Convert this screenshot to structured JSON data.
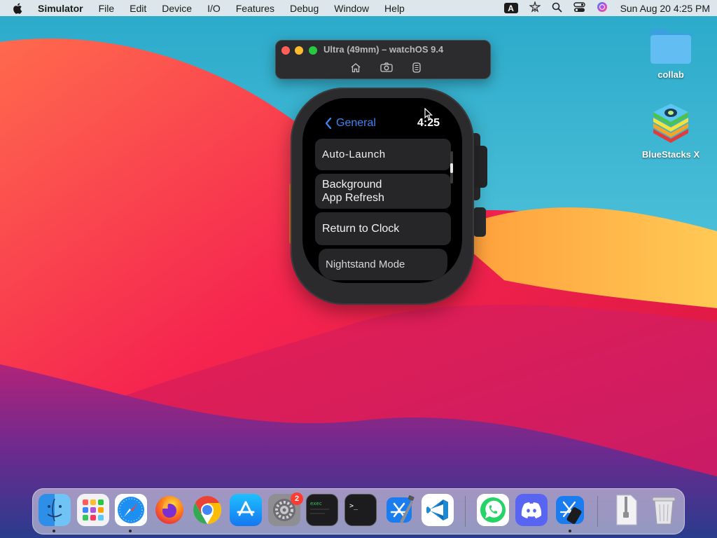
{
  "menubar": {
    "app_name": "Simulator",
    "items": [
      "File",
      "Edit",
      "Device",
      "I/O",
      "Features",
      "Debug",
      "Window",
      "Help"
    ],
    "keyboard_badge": "A",
    "datetime": "Sun Aug 20  4:25 PM"
  },
  "desktop": {
    "icons": [
      {
        "label": "collab",
        "icon": "folder-icon"
      },
      {
        "label": "BlueStacks X",
        "icon": "bluestacks-icon"
      }
    ]
  },
  "simulator": {
    "title": "Ultra (49mm) – watchOS 9.4",
    "toolbar": [
      "home-icon",
      "screenshot-icon",
      "rotate-icon"
    ]
  },
  "watch": {
    "back_label": "General",
    "time": "4:25",
    "items": [
      "Auto-Launch",
      "Background\nApp Refresh",
      "Return to Clock",
      "Nightstand Mode"
    ]
  },
  "dock": {
    "apps": [
      "Finder",
      "Launchpad",
      "Safari",
      "Firefox",
      "Chrome",
      "App Store",
      "System Settings",
      "Console",
      "Terminal",
      "Xcode",
      "Visual Studio Code",
      "WhatsApp",
      "Discord",
      "Simulator",
      "Archive",
      "Trash"
    ],
    "settings_badge": "2"
  },
  "colors": {
    "accent_blue": "#3d86f5",
    "traffic_red": "#ff5f57",
    "traffic_yellow": "#febc2e",
    "traffic_green": "#28c840",
    "badge_red": "#ff3b30"
  }
}
